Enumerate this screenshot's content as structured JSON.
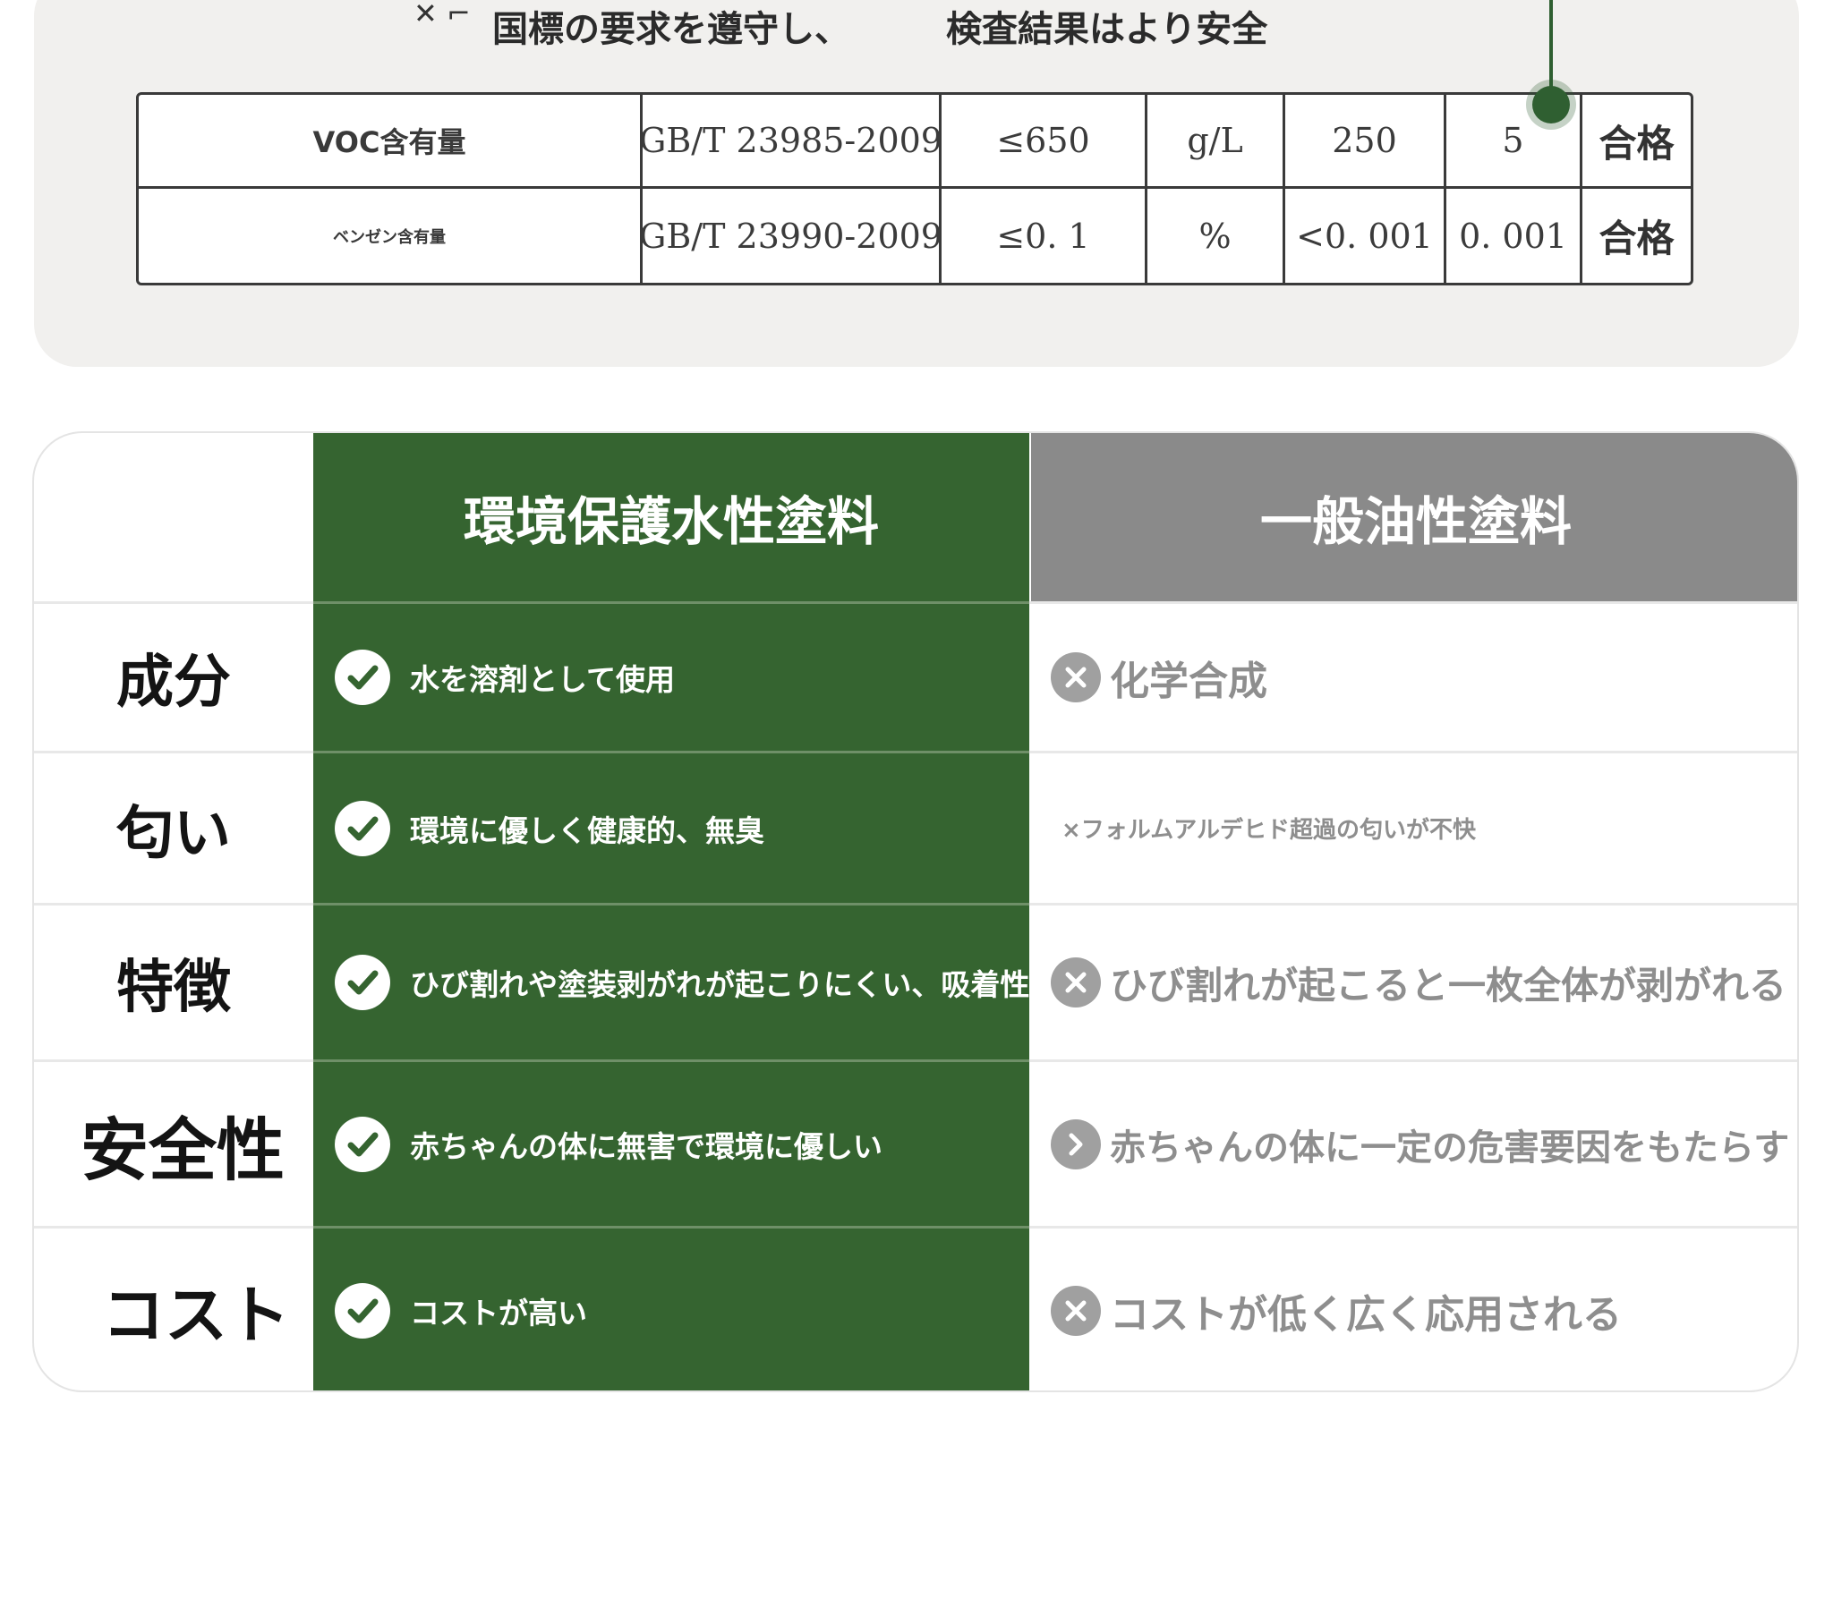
{
  "certificate": {
    "headline_left": "国標の要求を遵守し、",
    "headline_right": "検査結果はより安全",
    "rows": [
      {
        "item": "VOC含有量",
        "method": "GB/T 23985-2009",
        "limit": "≤650",
        "unit": "g/L",
        "value_a": "250",
        "value_b": "5",
        "result": "合格"
      },
      {
        "item": "ベンゼン含有量",
        "method": "GB/T 23990-2009",
        "limit": "≤0. 1",
        "unit": "%",
        "value_a": "<0. 001",
        "value_b": "0. 001",
        "result": "合格"
      }
    ]
  },
  "comparison": {
    "eco_title": "環境保護水性塗料",
    "oil_title": "一般油性塗料",
    "rows": [
      {
        "label": "成分",
        "eco": "水を溶剤として使用",
        "oil": "化学合成"
      },
      {
        "label": "匂い",
        "eco": "環境に優しく健康的、無臭",
        "oil": "×フォルムアルデヒド超過の匂いが不快"
      },
      {
        "label": "特徴",
        "eco": "ひび割れや塗装剥がれが起こりにくい、吸着性が強",
        "oil": "ひび割れが起こると一枚全体が剥がれる"
      },
      {
        "label": "安全性",
        "eco": "赤ちゃんの体に無害で環境に優しい",
        "oil": "赤ちゃんの体に一定の危害要因をもたらす"
      },
      {
        "label": "コスト",
        "eco": "コストが高い",
        "oil": "コストが低く広く応用される"
      }
    ],
    "colors": {
      "eco_green": "#356430",
      "oil_gray": "#8a8a8a"
    },
    "icons": {
      "eco": "check-icon",
      "oil": "cross-icon"
    }
  }
}
